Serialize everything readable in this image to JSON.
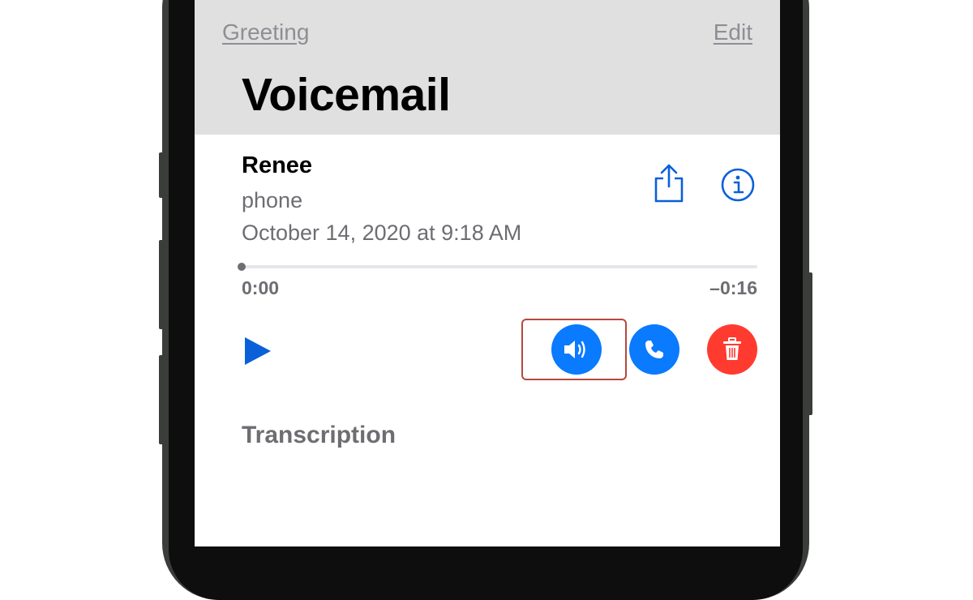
{
  "nav": {
    "greeting_label": "Greeting",
    "edit_label": "Edit"
  },
  "page_title": "Voicemail",
  "voicemail": {
    "contact_name": "Renee",
    "contact_label": "phone",
    "date": "October 14, 2020 at 9:18 AM",
    "progress_fraction": 0.0,
    "time_elapsed": "0:00",
    "time_remaining": "–0:16"
  },
  "actions": {
    "share_icon": "share-icon",
    "info_icon": "info-icon",
    "play_icon": "play-icon",
    "speaker_icon": "speaker-icon",
    "call_icon": "phone-icon",
    "delete_icon": "trash-icon"
  },
  "transcription_heading": "Transcription",
  "colors": {
    "accent": "#0a7aff",
    "destructive": "#ff3b30",
    "header_background": "#e0e0e1",
    "highlight_border": "#b5493d"
  }
}
